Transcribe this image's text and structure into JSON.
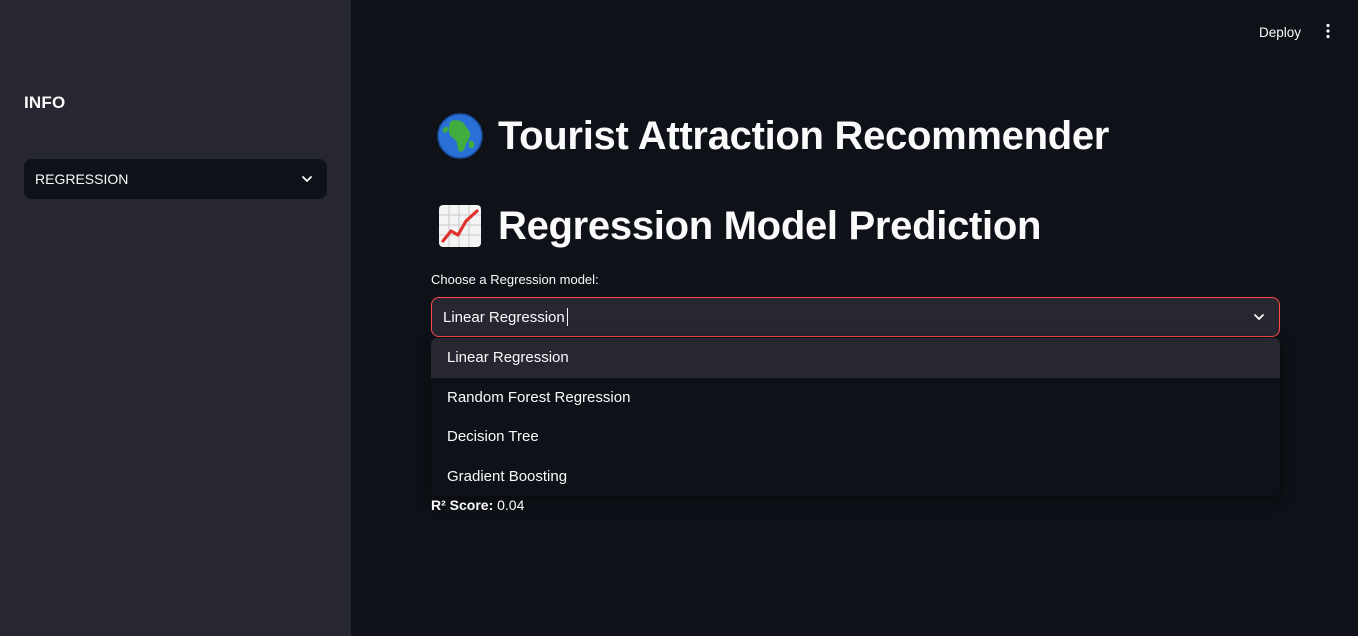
{
  "sidebar": {
    "title": "INFO",
    "select_value": "REGRESSION"
  },
  "header": {
    "deploy_label": "Deploy"
  },
  "main": {
    "title": "Tourist Attraction Recommender",
    "subtitle": "Regression Model Prediction",
    "select_label": "Choose a Regression model:",
    "select_value": "Linear Regression",
    "options": [
      "Linear Regression",
      "Random Forest Regression",
      "Decision Tree",
      "Gradient Boosting"
    ],
    "score_label": "R² Score:",
    "score_value": "0.04"
  },
  "colors": {
    "background": "#0e1117",
    "sidebar": "#262730",
    "accent": "#ff4b4b",
    "text": "#fafafa"
  },
  "icons": {
    "title_icon": "globe-africa-icon",
    "subtitle_icon": "chart-increasing-icon",
    "select_icon": "chevron-down-icon",
    "menu_icon": "kebab-menu-icon"
  }
}
